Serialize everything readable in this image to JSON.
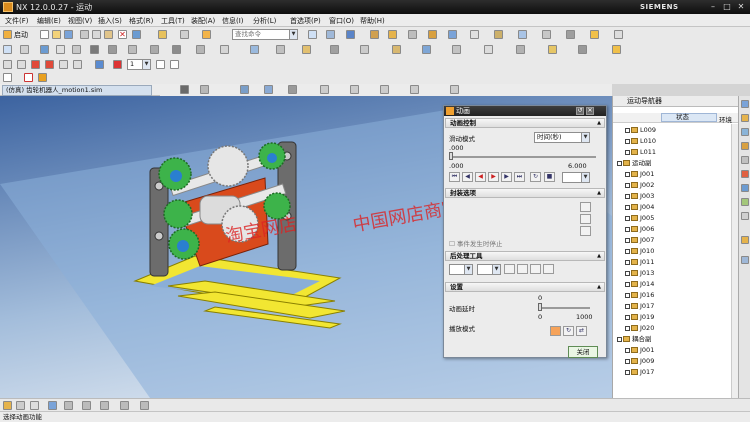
{
  "window": {
    "title": "NX 12.0.0.27 - 运动",
    "brand": "SIEMENS"
  },
  "menu": [
    "文件(F)",
    "编辑(E)",
    "视图(V)",
    "插入(S)",
    "格式(R)",
    "工具(T)",
    "装配(A)",
    "信息(I)",
    "分析(L)",
    "首选项(P)",
    "窗口(O)",
    "帮助(H)"
  ],
  "toolbar": {
    "start_label": "启动",
    "search_placeholder": "查找命令",
    "frame_value": "1"
  },
  "tab": {
    "label": "(仿真) 齿轮机器人_motion1.sim"
  },
  "watermark": {
    "line1": "淘宝网店",
    "line2": "中国网店商家"
  },
  "dialog": {
    "title": "动画",
    "section_control": "动画控制",
    "slide_mode_label": "滑动模式",
    "slide_mode_value": "时间(秒)",
    "time_current": ".000",
    "time_min": ".000",
    "time_max": "6.000",
    "section_package": "封装选项",
    "pkg_item": "事件发生时停止",
    "section_post": "后处理工具",
    "section_settings": "设置",
    "delay_label": "动画延时",
    "delay_value": "0",
    "delay_min": "0",
    "delay_max": "1000",
    "play_mode_label": "播放模式",
    "close_button": "关闭"
  },
  "navigator": {
    "title": "运动导航器",
    "col_status": "状态",
    "col_env": "环境",
    "rows": [
      {
        "label": "L009",
        "indent": 2
      },
      {
        "label": "L010",
        "indent": 2
      },
      {
        "label": "L011",
        "indent": 2
      },
      {
        "label": "运动副",
        "indent": 1
      },
      {
        "label": "J001",
        "indent": 2
      },
      {
        "label": "J002",
        "indent": 2
      },
      {
        "label": "J003",
        "indent": 2
      },
      {
        "label": "J004",
        "indent": 2
      },
      {
        "label": "J005",
        "indent": 2
      },
      {
        "label": "J006",
        "indent": 2
      },
      {
        "label": "J007",
        "indent": 2
      },
      {
        "label": "J010",
        "indent": 2
      },
      {
        "label": "J011",
        "indent": 2
      },
      {
        "label": "J013",
        "indent": 2
      },
      {
        "label": "J014",
        "indent": 2
      },
      {
        "label": "J016",
        "indent": 2
      },
      {
        "label": "J017",
        "indent": 2
      },
      {
        "label": "J019",
        "indent": 2
      },
      {
        "label": "J020",
        "indent": 2
      },
      {
        "label": "耦合副",
        "indent": 1
      },
      {
        "label": "J001",
        "indent": 2
      },
      {
        "label": "J009",
        "indent": 2
      },
      {
        "label": "J017",
        "indent": 2
      }
    ]
  },
  "status": {
    "text": "选择动画功能"
  },
  "colors": {
    "gear": "#3db34a",
    "frame": "#6c6c6c",
    "base": "#f2e632",
    "plate": "#d94a1c",
    "accent": "#f0a030"
  }
}
